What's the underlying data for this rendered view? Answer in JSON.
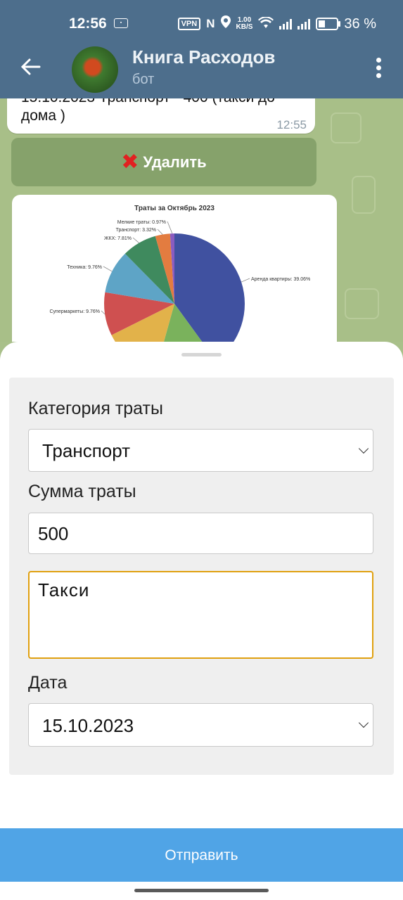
{
  "status_bar": {
    "time": "12:56",
    "vpn": "VPN",
    "nfc": "N",
    "speed_value": "1.00",
    "speed_unit": "KB/S",
    "battery_percent": "36 %",
    "battery_level": 0.36
  },
  "header": {
    "title": "Книга Расходов",
    "subtitle": "бот"
  },
  "chat": {
    "message_text": "15.10.2023 Транспорт - 400 (такси до дома )",
    "message_time": "12:55",
    "delete_label": "Удалить",
    "accent_red": "#e12121"
  },
  "chart_data": {
    "type": "pie",
    "title": "Траты за Октябрь 2023",
    "slices": [
      {
        "label": "Аренда квартиры: 39.06%",
        "value": 39.06,
        "color": "#4051a0"
      },
      {
        "label": "",
        "value": 14.0,
        "color": "#7ab25c"
      },
      {
        "label": "",
        "value": 13.0,
        "color": "#e2b24a"
      },
      {
        "label": "Супермаркеты: 9.76%",
        "value": 9.76,
        "color": "#cf5050"
      },
      {
        "label": "Техника: 9.76%",
        "value": 9.76,
        "color": "#5ea4c6"
      },
      {
        "label": "ЖКХ: 7.81%",
        "value": 7.81,
        "color": "#3f8a5e"
      },
      {
        "label": "Транспорт: 3.32%",
        "value": 3.32,
        "color": "#e37c40"
      },
      {
        "label": "Мелкие траты: 0.97%",
        "value": 0.97,
        "color": "#8a5cc0"
      }
    ]
  },
  "form": {
    "category_label": "Категория траты",
    "category_value": "Транспорт",
    "amount_label": "Сумма траты",
    "amount_value": "500",
    "comment_value": "Такси",
    "date_label": "Дата",
    "date_value": "15.10.2023"
  },
  "submit_label": "Отправить",
  "colors": {
    "header_bg": "#4d6e8c",
    "submit_bg": "#50a4e6",
    "focus_border": "#e0a00f"
  }
}
